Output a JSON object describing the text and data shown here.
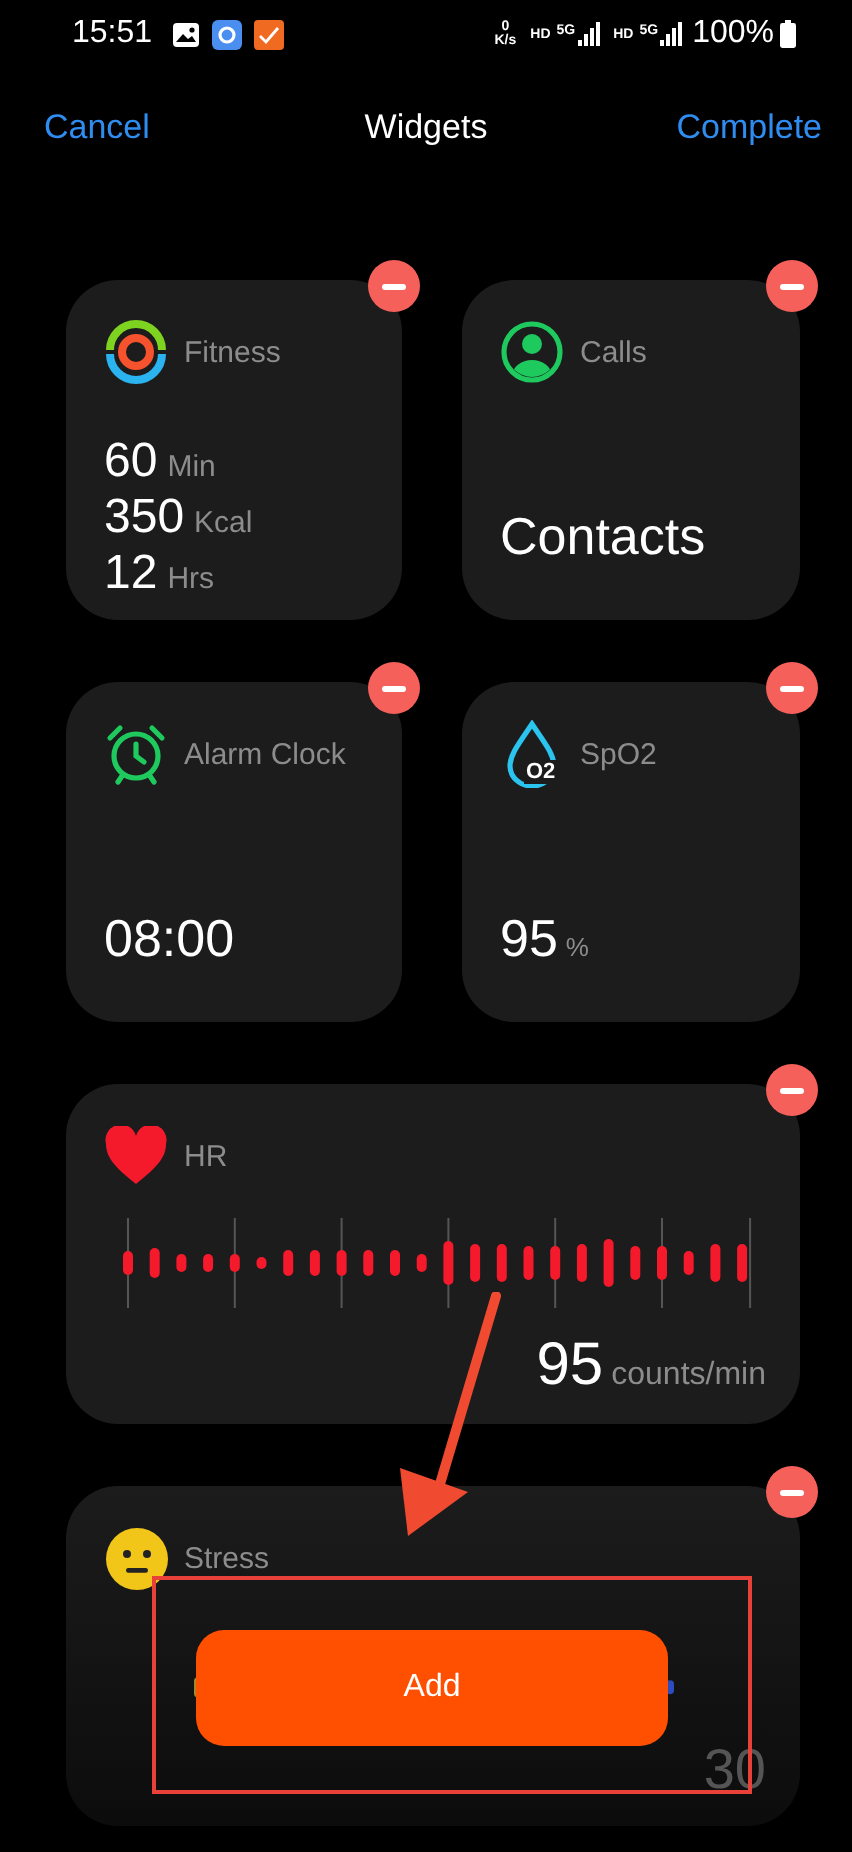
{
  "status_bar": {
    "time": "15:51",
    "net_speed_value": "0",
    "net_speed_unit": "K/s",
    "networks": [
      {
        "badge": "HD",
        "type": "5G"
      },
      {
        "badge": "HD",
        "type": "5G"
      }
    ],
    "battery": "100%"
  },
  "nav": {
    "cancel": "Cancel",
    "title": "Widgets",
    "complete": "Complete"
  },
  "widgets": [
    {
      "kind": "fitness",
      "title": "Fitness",
      "metrics": [
        {
          "value": "60",
          "unit": "Min"
        },
        {
          "value": "350",
          "unit": "Kcal"
        },
        {
          "value": "12",
          "unit": "Hrs"
        }
      ]
    },
    {
      "kind": "calls",
      "title": "Calls",
      "value": "Contacts"
    },
    {
      "kind": "alarm",
      "title": "Alarm Clock",
      "value": "08:00"
    },
    {
      "kind": "spo2",
      "title": "SpO2",
      "icon_label": "O2",
      "value": "95",
      "unit": "%"
    },
    {
      "kind": "hr",
      "title": "HR",
      "value": "95",
      "unit": "counts/min"
    },
    {
      "kind": "stress",
      "title": "Stress",
      "value": "30"
    }
  ],
  "add_button": {
    "label": "Add"
  }
}
